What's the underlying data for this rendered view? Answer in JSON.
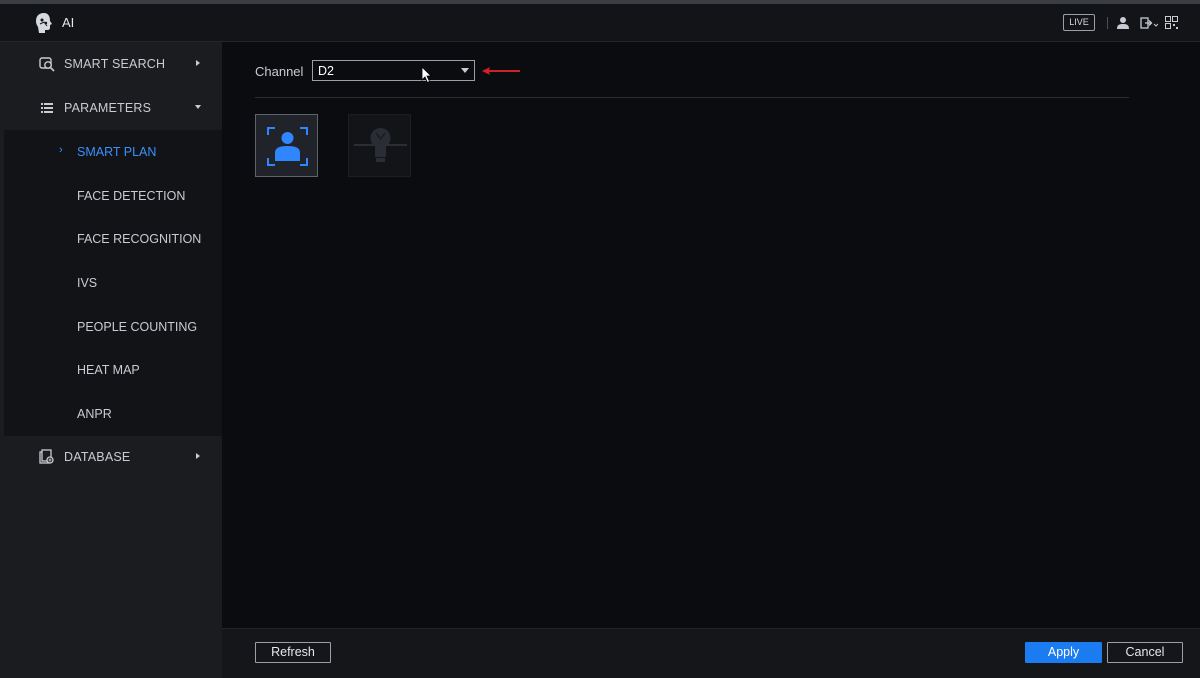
{
  "header": {
    "title": "AI",
    "live_label": "LIVE",
    "icons": [
      "app-logo-icon",
      "user-icon",
      "logout-icon",
      "qr-code-icon"
    ]
  },
  "sidebar": {
    "items": [
      {
        "label": "SMART SEARCH",
        "icon": "search-icon"
      },
      {
        "label": "PARAMETERS",
        "icon": "list-icon"
      },
      {
        "label": "DATABASE",
        "icon": "database-icon"
      }
    ],
    "sub_items": [
      {
        "label": "SMART PLAN",
        "active": true
      },
      {
        "label": "FACE DETECTION"
      },
      {
        "label": "FACE RECOGNITION"
      },
      {
        "label": "IVS"
      },
      {
        "label": "PEOPLE COUNTING"
      },
      {
        "label": "HEAT MAP"
      },
      {
        "label": "ANPR"
      }
    ]
  },
  "main": {
    "channel_label": "Channel",
    "channel_value": "D2",
    "plans": [
      {
        "icon": "face-plan-icon",
        "selected": true
      },
      {
        "icon": "ivs-plan-icon",
        "selected": false
      }
    ]
  },
  "footer": {
    "refresh_label": "Refresh",
    "apply_label": "Apply",
    "cancel_label": "Cancel"
  },
  "colors": {
    "accent": "#1a7cf0",
    "active_text": "#3b8fff",
    "annotation_arrow": "#d0212a",
    "background": "#0b0c0f"
  }
}
